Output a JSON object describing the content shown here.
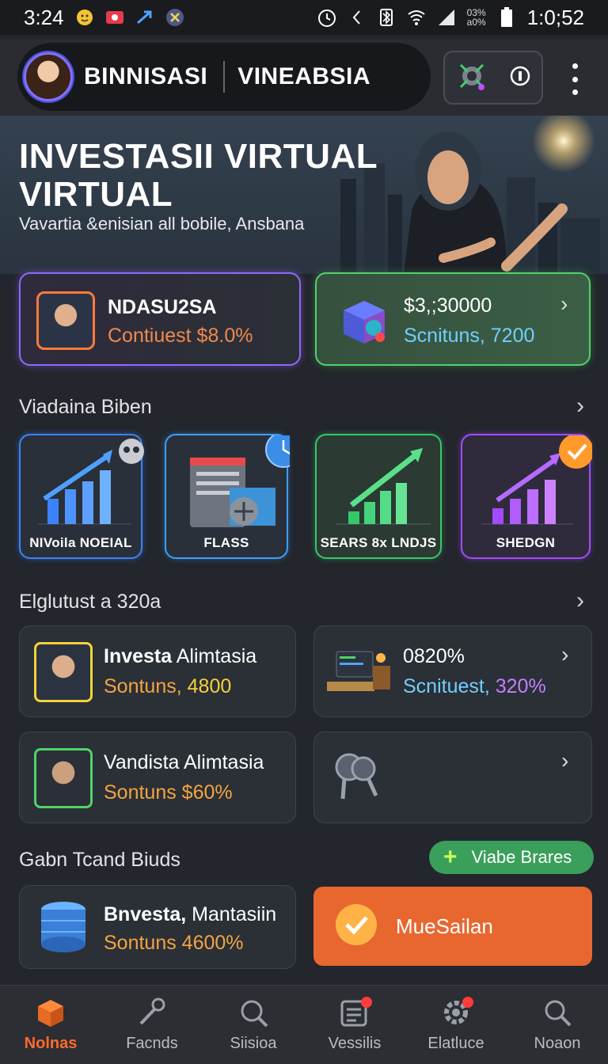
{
  "status": {
    "time": "3:24",
    "clock": "1:0;52",
    "net_top": "03%",
    "net_bottom": "a0%"
  },
  "header": {
    "brand_primary": "BINNISASI",
    "brand_secondary": "VINEABSIA",
    "avatar_icon": "profile-avatar"
  },
  "hero": {
    "title": "INVESTASII VIRTUAL VIRTUAL",
    "subtitle": "Vavartia &enisian all bobile, Ansbana"
  },
  "top_cards": [
    {
      "title": "NDASU2SA",
      "subtitle": "Contiuest $8.0%"
    },
    {
      "title": "$3,;30000",
      "subtitle": "Scnituns, 7200"
    }
  ],
  "section1": {
    "title": "Viadaina Biben"
  },
  "tiles": [
    {
      "label": "NIVoila NOEIAL",
      "color": "#3b82ff"
    },
    {
      "label": "FLASS",
      "color": "#3aa0ff"
    },
    {
      "label": "SEARS 8x LNDJS",
      "color": "#35c86a"
    },
    {
      "label": "SHEDGN",
      "color": "#a24bff"
    }
  ],
  "section2": {
    "title": "Elglutust a 320a"
  },
  "list_cards": [
    {
      "title_bold": "Investa",
      "title_rest": " Alimtasia",
      "sub_a": "Sontuns, ",
      "sub_b": "4800"
    },
    {
      "title": "0820%",
      "sub_a": "Scnituest, ",
      "sub_b": "320%"
    },
    {
      "title": "Vandista Alimtasia",
      "sub": "Sontuns $60%"
    }
  ],
  "section3": {
    "title": "Gabn Tcand Biuds",
    "pill": "Viabe Brares"
  },
  "bottom_cards": [
    {
      "title_bold": "Bnvesta,",
      "title_rest": " Mantasiin",
      "sub": "Sontuns 4600%"
    },
    {
      "action": "MueSailan"
    }
  ],
  "nav": [
    {
      "label": "Nolnas",
      "icon": "box-icon"
    },
    {
      "label": "Facnds",
      "icon": "tool-icon"
    },
    {
      "label": "Siisioa",
      "icon": "search-icon"
    },
    {
      "label": "Vessilis",
      "icon": "list-icon"
    },
    {
      "label": "Elatluce",
      "icon": "gear-icon"
    },
    {
      "label": "Noaon",
      "icon": "search-icon"
    }
  ],
  "colors": {
    "accent_orange": "#ff6a2b",
    "accent_green": "#3fbf5f",
    "accent_purple": "#a24bff",
    "accent_blue": "#3b82ff"
  }
}
